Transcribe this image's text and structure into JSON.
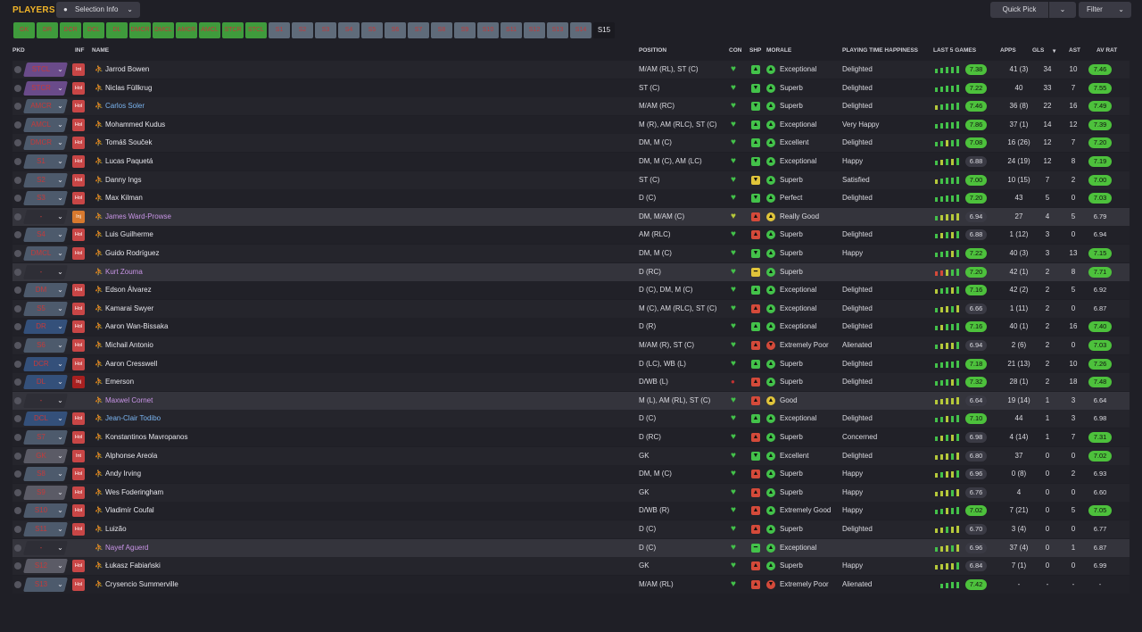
{
  "header": {
    "title": "PLAYERS",
    "selection_info": "Selection Info",
    "quick_pick": "Quick Pick",
    "filter": "Filter"
  },
  "position_chips": [
    {
      "label": "GK",
      "state": "on"
    },
    {
      "label": "DR",
      "state": "on"
    },
    {
      "label": "DCR",
      "state": "on"
    },
    {
      "label": "DCL",
      "state": "on"
    },
    {
      "label": "DL",
      "state": "on"
    },
    {
      "label": "DMCR",
      "state": "on"
    },
    {
      "label": "DMCL",
      "state": "on"
    },
    {
      "label": "AMCR",
      "state": "on"
    },
    {
      "label": "AMCL",
      "state": "on"
    },
    {
      "label": "STCR",
      "state": "on"
    },
    {
      "label": "STCL",
      "state": "on"
    },
    {
      "label": "S1",
      "state": "off"
    },
    {
      "label": "S2",
      "state": "off"
    },
    {
      "label": "S3",
      "state": "off"
    },
    {
      "label": "S4",
      "state": "off"
    },
    {
      "label": "S5",
      "state": "off"
    },
    {
      "label": "S6",
      "state": "off"
    },
    {
      "label": "S7",
      "state": "off"
    },
    {
      "label": "S8",
      "state": "off"
    },
    {
      "label": "S9",
      "state": "off"
    },
    {
      "label": "S10",
      "state": "off"
    },
    {
      "label": "S11",
      "state": "off"
    },
    {
      "label": "S12",
      "state": "off"
    },
    {
      "label": "S13",
      "state": "off"
    },
    {
      "label": "S14",
      "state": "off"
    },
    {
      "label": "S15",
      "state": "selected"
    }
  ],
  "columns": {
    "pkd": "PKD",
    "inf": "INF",
    "name": "NAME",
    "position": "POSITION",
    "con": "CON",
    "shp": "SHP",
    "morale": "MORALE",
    "pth": "PLAYING TIME HAPPINESS",
    "last5": "LAST 5 GAMES",
    "apps": "APPS",
    "gls": "GLS",
    "ast": "AST",
    "avrat": "AV RAT"
  },
  "colors": {
    "accent": "#f0b429",
    "chip_on": "#3f9b3c",
    "chip_off": "#5f6b7a",
    "good": "#43c24a",
    "bad": "#d44a3a",
    "warn": "#e0c43a"
  },
  "players": [
    {
      "pkd": "STCL",
      "pkd_bg": "purple",
      "inf": "Int",
      "inf_type": "int",
      "name": "Jarrod Bowen",
      "name_color": "white",
      "position": "M/AM (RL), ST (C)",
      "con": "good",
      "shp": "g",
      "shp_icon": "up",
      "mor": "g",
      "mor_icon": "up",
      "morale": "Exceptional",
      "pth": "Delighted",
      "last5": [
        "g",
        "g",
        "g",
        "g",
        "g"
      ],
      "avg": "7.38",
      "avg_hi": true,
      "apps": "41 (3)",
      "gls": "34",
      "ast": "10",
      "avrat": "7.46",
      "avrat_hi": true,
      "band": "odd"
    },
    {
      "pkd": "STCR",
      "pkd_bg": "purple",
      "inf": "Hol",
      "inf_type": "hol",
      "name": "Niclas Füllkrug",
      "name_color": "white",
      "position": "ST (C)",
      "con": "good",
      "shp": "g",
      "shp_icon": "down",
      "mor": "g",
      "mor_icon": "up",
      "morale": "Superb",
      "pth": "Delighted",
      "last5": [
        "g",
        "g",
        "g",
        "g",
        "g"
      ],
      "avg": "7.22",
      "avg_hi": true,
      "apps": "40",
      "gls": "33",
      "ast": "7",
      "avrat": "7.55",
      "avrat_hi": true,
      "band": "even"
    },
    {
      "pkd": "AMCR",
      "pkd_bg": "slate",
      "inf": "Hol",
      "inf_type": "hol",
      "name": "Carlos Soler",
      "name_color": "blue",
      "position": "M/AM (RC)",
      "con": "good",
      "shp": "g",
      "shp_icon": "down",
      "mor": "g",
      "mor_icon": "up",
      "morale": "Superb",
      "pth": "Delighted",
      "last5": [
        "y",
        "g",
        "g",
        "g",
        "g"
      ],
      "avg": "7.46",
      "avg_hi": true,
      "apps": "36 (8)",
      "gls": "22",
      "ast": "16",
      "avrat": "7.49",
      "avrat_hi": true,
      "band": "odd"
    },
    {
      "pkd": "AMCL",
      "pkd_bg": "slate",
      "inf": "Hol",
      "inf_type": "hol",
      "name": "Mohammed Kudus",
      "name_color": "white",
      "position": "M (R), AM (RLC), ST (C)",
      "con": "good",
      "shp": "g",
      "shp_icon": "up",
      "mor": "g",
      "mor_icon": "up",
      "morale": "Exceptional",
      "pth": "Very Happy",
      "last5": [
        "g",
        "g",
        "g",
        "g",
        "g"
      ],
      "avg": "7.86",
      "avg_hi": true,
      "apps": "37 (1)",
      "gls": "14",
      "ast": "12",
      "avrat": "7.39",
      "avrat_hi": true,
      "band": "even"
    },
    {
      "pkd": "DMCR",
      "pkd_bg": "slate",
      "inf": "Hol",
      "inf_type": "hol",
      "name": "Tomáš Souček",
      "name_color": "white",
      "position": "DM, M (C)",
      "con": "good",
      "shp": "g",
      "shp_icon": "up",
      "mor": "g",
      "mor_icon": "up",
      "morale": "Excellent",
      "pth": "Delighted",
      "last5": [
        "g",
        "g",
        "y",
        "g",
        "g"
      ],
      "avg": "7.08",
      "avg_hi": true,
      "apps": "16 (26)",
      "gls": "12",
      "ast": "7",
      "avrat": "7.20",
      "avrat_hi": true,
      "band": "odd"
    },
    {
      "pkd": "S1",
      "pkd_bg": "slate",
      "inf": "Hol",
      "inf_type": "hol",
      "name": "Lucas Paquetá",
      "name_color": "white",
      "position": "DM, M (C), AM (LC)",
      "con": "good",
      "shp": "g",
      "shp_icon": "down",
      "mor": "g",
      "mor_icon": "up",
      "morale": "Exceptional",
      "pth": "Happy",
      "last5": [
        "g",
        "y",
        "g",
        "y",
        "g"
      ],
      "avg": "6.88",
      "avg_hi": false,
      "apps": "24 (19)",
      "gls": "12",
      "ast": "8",
      "avrat": "7.19",
      "avrat_hi": true,
      "band": "even"
    },
    {
      "pkd": "S2",
      "pkd_bg": "slate",
      "inf": "Hol",
      "inf_type": "hol",
      "name": "Danny Ings",
      "name_color": "white",
      "position": "ST (C)",
      "con": "good",
      "shp": "y",
      "shp_icon": "down",
      "mor": "g",
      "mor_icon": "up",
      "morale": "Superb",
      "pth": "Satisfied",
      "last5": [
        "y",
        "g",
        "g",
        "g",
        "g"
      ],
      "avg": "7.00",
      "avg_hi": true,
      "apps": "10 (15)",
      "gls": "7",
      "ast": "2",
      "avrat": "7.00",
      "avrat_hi": true,
      "band": "odd"
    },
    {
      "pkd": "S3",
      "pkd_bg": "slate",
      "inf": "Hol",
      "inf_type": "hol",
      "name": "Max Kilman",
      "name_color": "white",
      "position": "D (C)",
      "con": "good",
      "shp": "g",
      "shp_icon": "down",
      "mor": "g",
      "mor_icon": "up",
      "morale": "Perfect",
      "pth": "Delighted",
      "last5": [
        "g",
        "g",
        "g",
        "g",
        "g"
      ],
      "avg": "7.20",
      "avg_hi": true,
      "apps": "43",
      "gls": "5",
      "ast": "0",
      "avrat": "7.03",
      "avrat_hi": true,
      "band": "even"
    },
    {
      "pkd": "-",
      "pkd_bg": "none",
      "inf": "Inj",
      "inf_type": "injo",
      "name": "James Ward-Prowse",
      "name_color": "purple",
      "position": "DM, M/AM (C)",
      "con": "warn",
      "shp": "r",
      "shp_icon": "up",
      "mor": "y",
      "mor_icon": "up",
      "morale": "Really Good",
      "pth": "",
      "last5": [
        "g",
        "y",
        "y",
        "y",
        "y"
      ],
      "avg": "6.94",
      "avg_hi": false,
      "apps": "27",
      "gls": "4",
      "ast": "5",
      "avrat": "6.79",
      "avrat_hi": false,
      "band": "grey"
    },
    {
      "pkd": "S4",
      "pkd_bg": "slate",
      "inf": "Hol",
      "inf_type": "hol",
      "name": "Luis Guilherme",
      "name_color": "white",
      "position": "AM (RLC)",
      "con": "good",
      "shp": "r",
      "shp_icon": "up",
      "mor": "g",
      "mor_icon": "up",
      "morale": "Superb",
      "pth": "Delighted",
      "last5": [
        "g",
        "y",
        "g",
        "y",
        "g"
      ],
      "avg": "6.88",
      "avg_hi": false,
      "apps": "1 (12)",
      "gls": "3",
      "ast": "0",
      "avrat": "6.94",
      "avrat_hi": false,
      "band": "even"
    },
    {
      "pkd": "DMCL",
      "pkd_bg": "slate",
      "inf": "Hol",
      "inf_type": "hol",
      "name": "Guido Rodríguez",
      "name_color": "white",
      "position": "DM, M (C)",
      "con": "good",
      "shp": "g",
      "shp_icon": "down",
      "mor": "g",
      "mor_icon": "up",
      "morale": "Superb",
      "pth": "Happy",
      "last5": [
        "g",
        "g",
        "g",
        "y",
        "g"
      ],
      "avg": "7.22",
      "avg_hi": true,
      "apps": "40 (3)",
      "gls": "3",
      "ast": "13",
      "avrat": "7.15",
      "avrat_hi": true,
      "band": "odd"
    },
    {
      "pkd": "-",
      "pkd_bg": "none",
      "inf": "",
      "inf_type": "none",
      "name": "Kurt Zouma",
      "name_color": "purple",
      "position": "D (RC)",
      "con": "good",
      "shp": "y",
      "shp_icon": "flat",
      "mor": "g",
      "mor_icon": "up",
      "morale": "Superb",
      "pth": "",
      "last5": [
        "r",
        "r",
        "y",
        "g",
        "g"
      ],
      "avg": "7.20",
      "avg_hi": true,
      "apps": "42 (1)",
      "gls": "2",
      "ast": "8",
      "avrat": "7.71",
      "avrat_hi": true,
      "band": "grey"
    },
    {
      "pkd": "DM",
      "pkd_bg": "slate",
      "inf": "Hol",
      "inf_type": "hol",
      "name": "Edson Álvarez",
      "name_color": "white",
      "position": "D (C), DM, M (C)",
      "con": "good",
      "shp": "g",
      "shp_icon": "up",
      "mor": "g",
      "mor_icon": "up",
      "morale": "Exceptional",
      "pth": "Delighted",
      "last5": [
        "y",
        "g",
        "g",
        "y",
        "g"
      ],
      "avg": "7.16",
      "avg_hi": true,
      "apps": "42 (2)",
      "gls": "2",
      "ast": "5",
      "avrat": "6.92",
      "avrat_hi": false,
      "band": "even"
    },
    {
      "pkd": "S5",
      "pkd_bg": "slate",
      "inf": "Hol",
      "inf_type": "hol",
      "name": "Kamarai Swyer",
      "name_color": "white",
      "position": "M (C), AM (RLC), ST (C)",
      "con": "good",
      "shp": "r",
      "shp_icon": "up",
      "mor": "g",
      "mor_icon": "up",
      "morale": "Exceptional",
      "pth": "Delighted",
      "last5": [
        "g",
        "y",
        "y",
        "g",
        "y"
      ],
      "avg": "6.66",
      "avg_hi": false,
      "apps": "1 (11)",
      "gls": "2",
      "ast": "0",
      "avrat": "6.87",
      "avrat_hi": false,
      "band": "odd"
    },
    {
      "pkd": "DR",
      "pkd_bg": "blue",
      "inf": "Hol",
      "inf_type": "hol",
      "name": "Aaron Wan-Bissaka",
      "name_color": "white",
      "position": "D (R)",
      "con": "good",
      "shp": "g",
      "shp_icon": "up",
      "mor": "g",
      "mor_icon": "up",
      "morale": "Exceptional",
      "pth": "Delighted",
      "last5": [
        "g",
        "y",
        "g",
        "g",
        "g"
      ],
      "avg": "7.16",
      "avg_hi": true,
      "apps": "40 (1)",
      "gls": "2",
      "ast": "16",
      "avrat": "7.40",
      "avrat_hi": true,
      "band": "even"
    },
    {
      "pkd": "S6",
      "pkd_bg": "slate",
      "inf": "Hol",
      "inf_type": "hol",
      "name": "Michail Antonio",
      "name_color": "white",
      "position": "M/AM (R), ST (C)",
      "con": "good",
      "shp": "r",
      "shp_icon": "up",
      "mor": "r",
      "mor_icon": "down",
      "morale": "Extremely Poor",
      "pth": "Alienated",
      "last5": [
        "g",
        "y",
        "y",
        "y",
        "g"
      ],
      "avg": "6.94",
      "avg_hi": false,
      "apps": "2 (6)",
      "gls": "2",
      "ast": "0",
      "avrat": "7.03",
      "avrat_hi": true,
      "band": "odd"
    },
    {
      "pkd": "DCR",
      "pkd_bg": "blue",
      "inf": "Hol",
      "inf_type": "hol",
      "name": "Aaron Cresswell",
      "name_color": "white",
      "position": "D (LC), WB (L)",
      "con": "good",
      "shp": "g",
      "shp_icon": "up",
      "mor": "g",
      "mor_icon": "up",
      "morale": "Superb",
      "pth": "Delighted",
      "last5": [
        "g",
        "g",
        "g",
        "g",
        "g"
      ],
      "avg": "7.18",
      "avg_hi": true,
      "apps": "21 (13)",
      "gls": "2",
      "ast": "10",
      "avrat": "7.26",
      "avrat_hi": true,
      "band": "even"
    },
    {
      "pkd": "DL",
      "pkd_bg": "blue",
      "inf": "Inj",
      "inf_type": "inj",
      "name": "Emerson",
      "name_color": "white",
      "position": "D/WB (L)",
      "con": "bad",
      "shp": "r",
      "shp_icon": "up",
      "mor": "g",
      "mor_icon": "up",
      "morale": "Superb",
      "pth": "Delighted",
      "last5": [
        "g",
        "g",
        "g",
        "y",
        "g"
      ],
      "avg": "7.32",
      "avg_hi": true,
      "apps": "28 (1)",
      "gls": "2",
      "ast": "18",
      "avrat": "7.48",
      "avrat_hi": true,
      "band": "odd"
    },
    {
      "pkd": "-",
      "pkd_bg": "none",
      "inf": "",
      "inf_type": "none",
      "name": "Maxwel Cornet",
      "name_color": "purple",
      "position": "M (L), AM (RL), ST (C)",
      "con": "good",
      "shp": "r",
      "shp_icon": "up",
      "mor": "y",
      "mor_icon": "up",
      "morale": "Good",
      "pth": "",
      "last5": [
        "y",
        "y",
        "y",
        "y",
        "y"
      ],
      "avg": "6.64",
      "avg_hi": false,
      "apps": "19 (14)",
      "gls": "1",
      "ast": "3",
      "avrat": "6.64",
      "avrat_hi": false,
      "band": "grey"
    },
    {
      "pkd": "DCL",
      "pkd_bg": "blue",
      "inf": "Hol",
      "inf_type": "hol",
      "name": "Jean-Clair Todibo",
      "name_color": "blue",
      "position": "D (C)",
      "con": "good",
      "shp": "g",
      "shp_icon": "up",
      "mor": "g",
      "mor_icon": "up",
      "morale": "Exceptional",
      "pth": "Delighted",
      "last5": [
        "g",
        "g",
        "y",
        "g",
        "g"
      ],
      "avg": "7.10",
      "avg_hi": true,
      "apps": "44",
      "gls": "1",
      "ast": "3",
      "avrat": "6.98",
      "avrat_hi": false,
      "band": "odd"
    },
    {
      "pkd": "S7",
      "pkd_bg": "slate",
      "inf": "Hol",
      "inf_type": "hol",
      "name": "Konstantinos Mavropanos",
      "name_color": "white",
      "position": "D (RC)",
      "con": "good",
      "shp": "r",
      "shp_icon": "up",
      "mor": "g",
      "mor_icon": "up",
      "morale": "Superb",
      "pth": "Concerned",
      "last5": [
        "g",
        "y",
        "g",
        "y",
        "g"
      ],
      "avg": "6.98",
      "avg_hi": false,
      "apps": "4 (14)",
      "gls": "1",
      "ast": "7",
      "avrat": "7.31",
      "avrat_hi": true,
      "band": "even"
    },
    {
      "pkd": "GK",
      "pkd_bg": "grey",
      "inf": "Int",
      "inf_type": "int",
      "name": "Alphonse Areola",
      "name_color": "white",
      "position": "GK",
      "con": "good",
      "shp": "g",
      "shp_icon": "down",
      "mor": "g",
      "mor_icon": "up",
      "morale": "Excellent",
      "pth": "Delighted",
      "last5": [
        "y",
        "y",
        "y",
        "g",
        "y"
      ],
      "avg": "6.80",
      "avg_hi": false,
      "apps": "37",
      "gls": "0",
      "ast": "0",
      "avrat": "7.02",
      "avrat_hi": true,
      "band": "odd"
    },
    {
      "pkd": "S8",
      "pkd_bg": "slate",
      "inf": "Hol",
      "inf_type": "hol",
      "name": "Andy Irving",
      "name_color": "white",
      "position": "DM, M (C)",
      "con": "good",
      "shp": "r",
      "shp_icon": "up",
      "mor": "g",
      "mor_icon": "up",
      "morale": "Superb",
      "pth": "Happy",
      "last5": [
        "y",
        "g",
        "y",
        "y",
        "g"
      ],
      "avg": "6.96",
      "avg_hi": false,
      "apps": "0 (8)",
      "gls": "0",
      "ast": "2",
      "avrat": "6.93",
      "avrat_hi": false,
      "band": "even"
    },
    {
      "pkd": "S9",
      "pkd_bg": "grey",
      "inf": "Hol",
      "inf_type": "hol",
      "name": "Wes Foderingham",
      "name_color": "white",
      "position": "GK",
      "con": "good",
      "shp": "r",
      "shp_icon": "up",
      "mor": "g",
      "mor_icon": "up",
      "morale": "Superb",
      "pth": "Happy",
      "last5": [
        "y",
        "y",
        "y",
        "g",
        "y"
      ],
      "avg": "6.76",
      "avg_hi": false,
      "apps": "4",
      "gls": "0",
      "ast": "0",
      "avrat": "6.60",
      "avrat_hi": false,
      "band": "odd"
    },
    {
      "pkd": "S10",
      "pkd_bg": "slate",
      "inf": "Hol",
      "inf_type": "hol",
      "name": "Vladimír Coufal",
      "name_color": "white",
      "position": "D/WB (R)",
      "con": "good",
      "shp": "r",
      "shp_icon": "up",
      "mor": "g",
      "mor_icon": "up",
      "morale": "Extremely Good",
      "pth": "Happy",
      "last5": [
        "g",
        "g",
        "y",
        "g",
        "g"
      ],
      "avg": "7.02",
      "avg_hi": true,
      "apps": "7 (21)",
      "gls": "0",
      "ast": "5",
      "avrat": "7.05",
      "avrat_hi": true,
      "band": "even"
    },
    {
      "pkd": "S11",
      "pkd_bg": "slate",
      "inf": "Hol",
      "inf_type": "hol",
      "name": "Luizão",
      "name_color": "white",
      "position": "D (C)",
      "con": "good",
      "shp": "r",
      "shp_icon": "up",
      "mor": "g",
      "mor_icon": "up",
      "morale": "Superb",
      "pth": "Delighted",
      "last5": [
        "y",
        "y",
        "g",
        "y",
        "y"
      ],
      "avg": "6.70",
      "avg_hi": false,
      "apps": "3 (4)",
      "gls": "0",
      "ast": "0",
      "avrat": "6.77",
      "avrat_hi": false,
      "band": "odd"
    },
    {
      "pkd": "-",
      "pkd_bg": "none",
      "inf": "",
      "inf_type": "none",
      "name": "Nayef Aguerd",
      "name_color": "purple",
      "position": "D (C)",
      "con": "good",
      "shp": "g",
      "shp_icon": "flat",
      "mor": "g",
      "mor_icon": "up",
      "morale": "Exceptional",
      "pth": "",
      "last5": [
        "g",
        "y",
        "y",
        "g",
        "y"
      ],
      "avg": "6.96",
      "avg_hi": false,
      "apps": "37 (4)",
      "gls": "0",
      "ast": "1",
      "avrat": "6.87",
      "avrat_hi": false,
      "band": "grey"
    },
    {
      "pkd": "S12",
      "pkd_bg": "grey",
      "inf": "Hol",
      "inf_type": "hol",
      "name": "Łukasz Fabiański",
      "name_color": "white",
      "position": "GK",
      "con": "good",
      "shp": "r",
      "shp_icon": "up",
      "mor": "g",
      "mor_icon": "up",
      "morale": "Superb",
      "pth": "Happy",
      "last5": [
        "y",
        "y",
        "y",
        "y",
        "g"
      ],
      "avg": "6.84",
      "avg_hi": false,
      "apps": "7 (1)",
      "gls": "0",
      "ast": "0",
      "avrat": "6.99",
      "avrat_hi": false,
      "band": "odd"
    },
    {
      "pkd": "S13",
      "pkd_bg": "slate",
      "inf": "Hol",
      "inf_type": "hol",
      "name": "Crysencio Summerville",
      "name_color": "white",
      "position": "M/AM (RL)",
      "con": "good",
      "shp": "r",
      "shp_icon": "up",
      "mor": "r",
      "mor_icon": "down",
      "morale": "Extremely Poor",
      "pth": "Alienated",
      "last5": [
        "g",
        "g",
        "g",
        "g"
      ],
      "avg": "7.42",
      "avg_hi": true,
      "apps": "-",
      "gls": "-",
      "ast": "-",
      "avrat": "-",
      "avrat_hi": false,
      "band": "even"
    }
  ]
}
